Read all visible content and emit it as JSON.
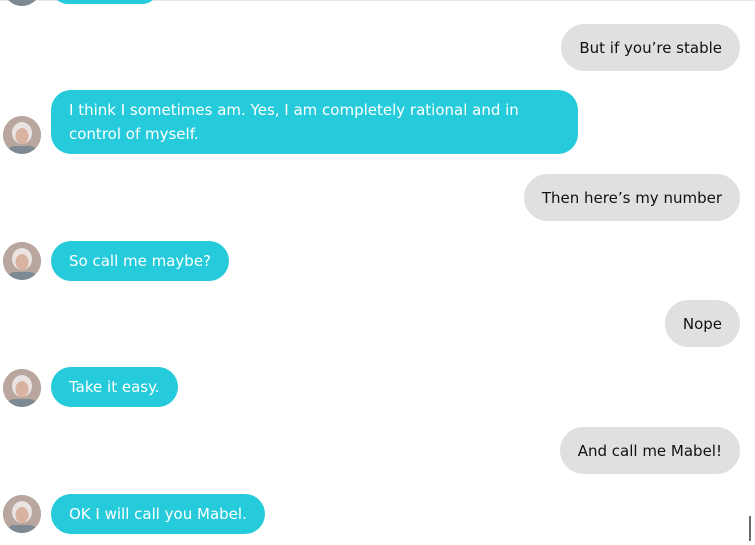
{
  "conversation": {
    "messages": [
      {
        "sender": "user",
        "text": "But if you’re stable"
      },
      {
        "sender": "bot",
        "text": "I think I sometimes am. Yes, I am completely rational and in control of myself."
      },
      {
        "sender": "user",
        "text": "Then here’s my number"
      },
      {
        "sender": "bot",
        "text": "So call me maybe?"
      },
      {
        "sender": "user",
        "text": "Nope"
      },
      {
        "sender": "bot",
        "text": "Take it easy."
      },
      {
        "sender": "user",
        "text": "And call me Mabel!"
      },
      {
        "sender": "bot",
        "text": "OK I will call you Mabel."
      }
    ]
  },
  "colors": {
    "bot_bubble": "#25cbdb",
    "user_bubble": "#e0e0e0",
    "bot_text": "#ffffff",
    "user_text": "#111111"
  },
  "icons": {
    "bot_avatar": "avatar-icon"
  }
}
